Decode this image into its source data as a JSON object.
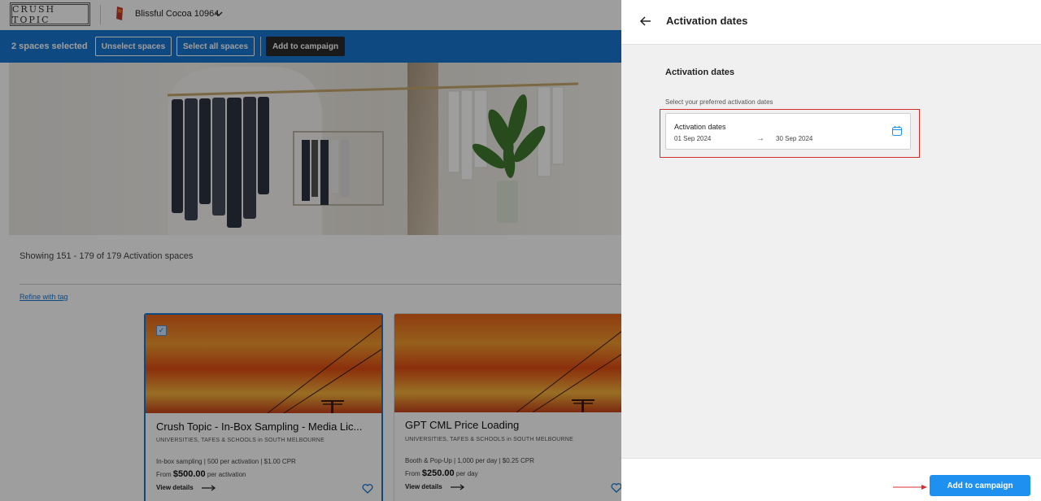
{
  "header": {
    "logo_text": "CRUSH TOPIC",
    "brand_name": "Blissful Cocoa 10964",
    "chevron_icon": "chevron-down-icon"
  },
  "selection_bar": {
    "count_label": "2 spaces selected",
    "unselect_label": "Unselect spaces",
    "select_all_label": "Select all spaces",
    "add_to_campaign_label": "Add to campaign",
    "bar_color": "#1976d2"
  },
  "listing": {
    "showing_text": "Showing 151 - 179 of 179 Activation spaces",
    "refine_link": "Refine with tag",
    "cards": [
      {
        "selected": true,
        "title": "Crush Topic - In-Box Sampling - Media Lic...",
        "subtitle": "UNIVERSITIES, TAFES & SCHOOLS in SOUTH MELBOURNE",
        "meta": "In-box sampling | 500 per activation | $1.00 CPR",
        "price_prefix": "From",
        "price": "$500.00",
        "price_suffix": "per activation",
        "view_details": "View details"
      },
      {
        "selected": false,
        "title": "GPT CML Price Loading",
        "subtitle": "UNIVERSITIES, TAFES & SCHOOLS in SOUTH MELBOURNE",
        "meta": "Booth & Pop-Up | 1,000 per day | $0.25 CPR",
        "price_prefix": "From",
        "price": "$250.00",
        "price_suffix": "per day",
        "view_details": "View details"
      }
    ]
  },
  "drawer": {
    "title": "Activation dates",
    "section_title": "Activation dates",
    "hint": "Select your preferred activation dates",
    "date_field": {
      "label": "Activation dates",
      "start": "01 Sep 2024",
      "arrow": "→",
      "end": "30 Sep 2024",
      "icon": "calendar-icon"
    },
    "add_button_label": "Add to campaign",
    "accent_color": "#1e90f0",
    "highlight_color": "#d32f2f"
  }
}
